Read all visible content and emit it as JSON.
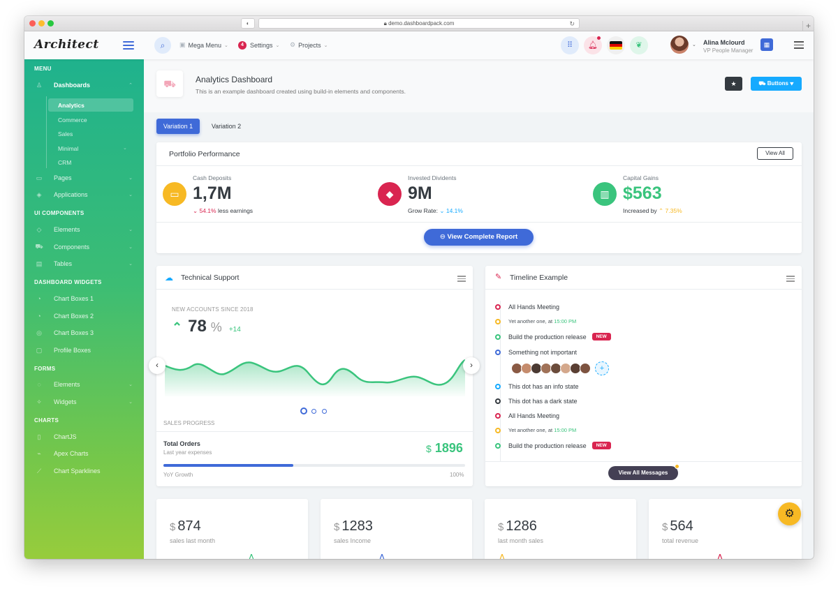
{
  "browser": {
    "url": "demo.dashboardpack.com"
  },
  "header": {
    "logo": "Architect",
    "nav": [
      {
        "label": "Mega Menu"
      },
      {
        "label": "Settings",
        "badge": "4"
      },
      {
        "label": "Projects"
      }
    ],
    "user": {
      "name": "Alina Mclourd",
      "role": "VP People Manager"
    }
  },
  "sidebar": {
    "sections": {
      "menu": "MENU",
      "ui_components": "UI COMPONENTS",
      "dashboard_widgets": "DASHBOARD WIDGETS",
      "forms": "FORMS",
      "charts": "CHARTS"
    },
    "items": {
      "dashboards": "Dashboards",
      "analytics": "Analytics",
      "commerce": "Commerce",
      "sales": "Sales",
      "minimal": "Minimal",
      "crm": "CRM",
      "pages": "Pages",
      "applications": "Applications",
      "elements": "Elements",
      "components": "Components",
      "tables": "Tables",
      "chart_boxes_1": "Chart Boxes 1",
      "chart_boxes_2": "Chart Boxes 2",
      "chart_boxes_3": "Chart Boxes 3",
      "profile_boxes": "Profile Boxes",
      "form_elements": "Elements",
      "widgets": "Widgets",
      "chartjs": "ChartJS",
      "apex_charts": "Apex Charts",
      "chart_sparklines": "Chart Sparklines"
    }
  },
  "page": {
    "title": "Analytics Dashboard",
    "subtitle": "This is an example dashboard created using build-in elements and components.",
    "buttons_label": "Buttons",
    "tabs": [
      "Variation 1",
      "Variation 2"
    ]
  },
  "portfolio": {
    "title": "Portfolio Performance",
    "view_all": "View All",
    "metrics": [
      {
        "label": "Cash Deposits",
        "value": "1,7M",
        "change": "54.1%",
        "note": "less earnings",
        "color": "#f7b924"
      },
      {
        "label": "Invested Dividents",
        "value": "9M",
        "prefix": "Grow Rate:",
        "change": "14.1%",
        "color": "#d92550"
      },
      {
        "label": "Capital Gains",
        "value": "$563",
        "prefix": "Increased by",
        "change": "7.35%",
        "color": "#3ac47d"
      }
    ],
    "report_button": "View Complete Report"
  },
  "support": {
    "title": "Technical Support",
    "subtitle": "NEW ACCOUNTS SINCE 2018",
    "value": "78",
    "unit": "%",
    "delta": "+14",
    "sales_progress": "SALES PROGRESS",
    "total_orders": "Total Orders",
    "orders_sub": "Last year expenses",
    "orders_currency": "$",
    "orders_value": "1896",
    "growth_label": "YoY Growth",
    "growth_percent": "100%",
    "progress_fill": 0.43
  },
  "timeline": {
    "title": "Timeline Example",
    "items": [
      {
        "text": "All Hands Meeting",
        "color": "#d92550"
      },
      {
        "text": "Yet another one, at",
        "time": "15:00 PM",
        "color": "#f7b924"
      },
      {
        "text": "Build the production release",
        "badge": "NEW",
        "color": "#3ac47d"
      },
      {
        "text": "Something not important",
        "color": "#3f6ad8"
      },
      {
        "text": "This dot has an info state",
        "color": "#16aaff"
      },
      {
        "text": "This dot has a dark state",
        "color": "#343a40"
      },
      {
        "text": "All Hands Meeting",
        "color": "#d92550"
      },
      {
        "text": "Yet another one, at",
        "time": "15:00 PM",
        "color": "#f7b924"
      },
      {
        "text": "Build the production release",
        "badge": "NEW",
        "color": "#3ac47d"
      }
    ],
    "view_messages": "View All Messages"
  },
  "stats": [
    {
      "currency": "$",
      "value": "874",
      "label": "sales last month"
    },
    {
      "currency": "$",
      "value": "1283",
      "label": "sales Income"
    },
    {
      "currency": "$",
      "value": "1286",
      "label": "last month sales"
    },
    {
      "currency": "$",
      "value": "564",
      "label": "total revenue"
    }
  ]
}
